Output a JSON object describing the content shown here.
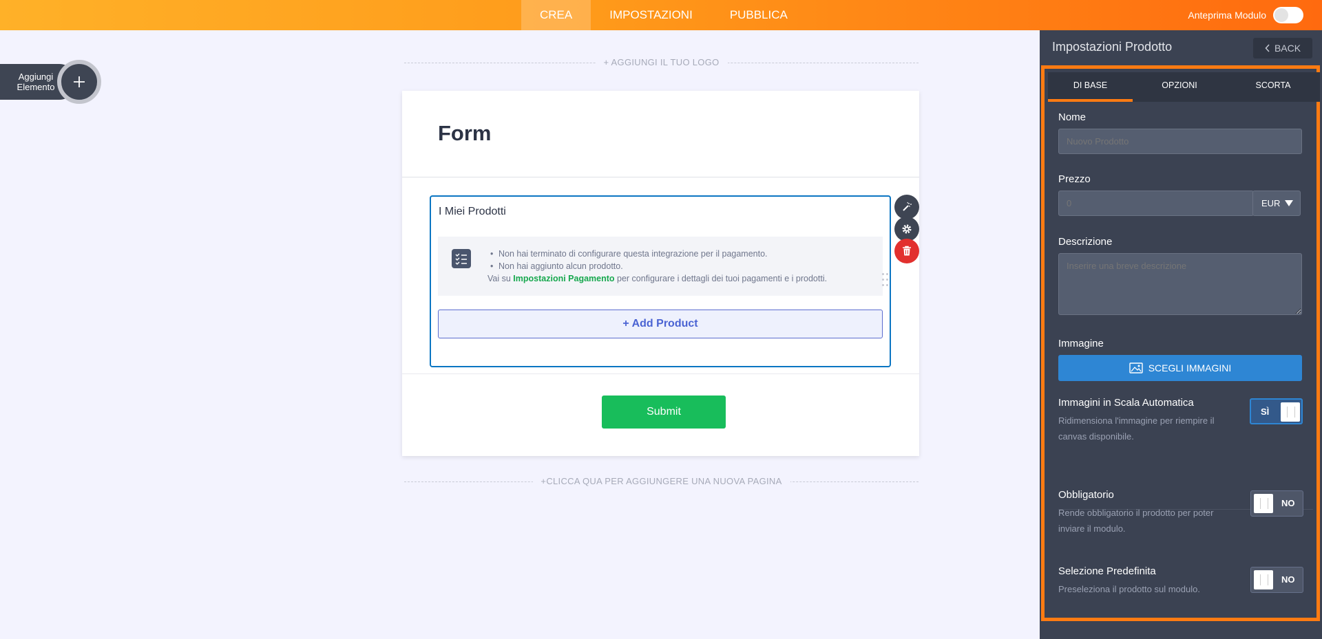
{
  "header": {
    "tabs": [
      {
        "label": "CREA",
        "active": true
      },
      {
        "label": "IMPOSTAZIONI",
        "active": false
      },
      {
        "label": "PUBBLICA",
        "active": false
      }
    ],
    "preview_label": "Anteprima Modulo",
    "preview_on": false
  },
  "add_element": {
    "label_line1": "Aggiungi",
    "label_line2": "Elemento",
    "plus": "+"
  },
  "canvas": {
    "add_logo": "+ AGGIUNGI IL TUO LOGO",
    "add_page": "+CLICCA QUA PER AGGIUNGERE UNA NUOVA PAGINA"
  },
  "form": {
    "title": "Form",
    "widget_title": "I Miei Prodotti",
    "warnings": [
      "Non hai terminato di configurare questa integrazione per il pagamento.",
      "Non hai aggiunto alcun prodotto."
    ],
    "hint_prefix": "Vai su ",
    "hint_link": "Impostazioni Pagamento",
    "hint_suffix": " per configurare i dettagli dei tuoi pagamenti e i prodotti.",
    "add_product": "+ Add Product",
    "submit": "Submit"
  },
  "panel": {
    "title": "Impostazioni Prodotto",
    "back": "BACK",
    "tabs": [
      {
        "label": "DI BASE",
        "active": true
      },
      {
        "label": "OPZIONI",
        "active": false
      },
      {
        "label": "SCORTA",
        "active": false
      }
    ],
    "name_label": "Nome",
    "name_placeholder": "Nuovo Prodotto",
    "price_label": "Prezzo",
    "price_placeholder": "0",
    "currency": "EUR",
    "desc_label": "Descrizione",
    "desc_placeholder": "Inserire una breve descrizione",
    "image_label": "Immagine",
    "image_button": "SCEGLI IMMAGINI",
    "autoscale_label": "Immagini in Scala Automatica",
    "autoscale_desc": "Ridimensiona l'immagine per riempire il canvas disponibile.",
    "autoscale_value": "SÌ",
    "required_label": "Obbligatorio",
    "required_desc": "Rende obbligatorio il prodotto per poter inviare il modulo.",
    "required_value": "NO",
    "default_label": "Selezione Predefinita",
    "default_desc": "Preseleziona il prodotto sul modulo.",
    "default_value": "NO"
  },
  "colors": {
    "header_start": "#ffb128",
    "header_end": "#ff6a0f",
    "accent": "#ff7b12",
    "panel_bg": "#3b4252",
    "submit": "#18bd5b",
    "link_green": "#17a84e",
    "delete_red": "#e2302e"
  }
}
